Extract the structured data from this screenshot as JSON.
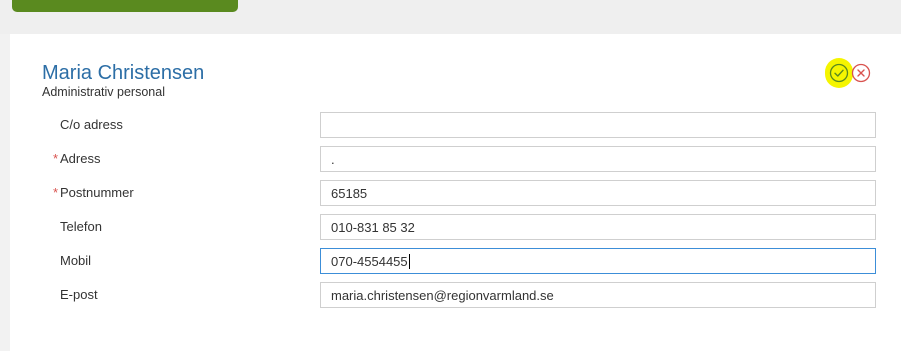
{
  "profile": {
    "name": "Maria Christensen",
    "role": "Administrativ personal"
  },
  "actions": {
    "confirm_icon": "check-circle-icon",
    "cancel_icon": "close-circle-icon",
    "confirm_color": "#5a8a1f",
    "cancel_color": "#d9534f",
    "highlight_color": "#f5f500"
  },
  "form": {
    "required_marker": "*",
    "fields": [
      {
        "label": "C/o adress",
        "value": "",
        "required": false
      },
      {
        "label": "Adress",
        "value": ".",
        "required": true
      },
      {
        "label": "Postnummer",
        "value": "65185",
        "required": true
      },
      {
        "label": "Telefon",
        "value": "010-831 85 32",
        "required": false
      },
      {
        "label": "Mobil",
        "value": "070-4554455",
        "required": false,
        "focused": true
      },
      {
        "label": "E-post",
        "value": "maria.christensen@regionvarmland.se",
        "required": false
      }
    ]
  }
}
